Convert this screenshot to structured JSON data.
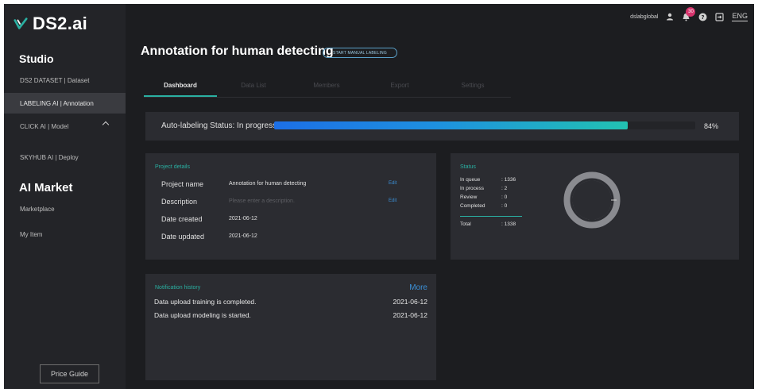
{
  "brand": {
    "name": "DS2.ai",
    "logo_icon": "check-logo-icon",
    "accent": "#2ab0a2"
  },
  "sidebar": {
    "studio_title": "Studio",
    "items": [
      {
        "label": "DS2 DATASET | Dataset"
      },
      {
        "label": "LABELING AI | Annotation",
        "active": true
      },
      {
        "label": "CLICK AI | Model",
        "icon": "chevron-up-icon"
      },
      {
        "label": "SKYHUB AI | Deploy"
      }
    ],
    "market_title": "AI Market",
    "market_items": [
      {
        "label": "Marketplace"
      },
      {
        "label": "My Item"
      }
    ],
    "price_guide": "Price Guide"
  },
  "topbar": {
    "username": "dslabglobal",
    "user_icon": "user-icon",
    "bell_icon": "bell-icon",
    "notification_count": "30",
    "help_icon": "help-icon",
    "logout_icon": "logout-icon",
    "language": "ENG"
  },
  "header": {
    "title": "Annotation for human detecting",
    "manual_button": "START MANUAL LABELING"
  },
  "tabs": [
    {
      "label": "Dashboard",
      "active": true
    },
    {
      "label": "Data List"
    },
    {
      "label": "Members"
    },
    {
      "label": "Export"
    },
    {
      "label": "Settings"
    }
  ],
  "progress": {
    "label": "Auto-labeling Status: In progress",
    "value": 0.84,
    "percent_text": "84%",
    "color_start": "#1c6fe6",
    "color_end": "#22c2b2"
  },
  "project_details": {
    "title": "Project details",
    "rows": [
      {
        "label": "Project name",
        "value": "Annotation for human detecting",
        "edit": "Edit"
      },
      {
        "label": "Description",
        "placeholder": "Please enter a description.",
        "edit": "Edit"
      },
      {
        "label": "Date created",
        "value": "2021-06-12"
      },
      {
        "label": "Date updated",
        "value": "2021-06-12"
      }
    ]
  },
  "status": {
    "title": "Status",
    "rows": [
      {
        "key": "In queue",
        "value": ": 1336"
      },
      {
        "key": "In process",
        "value": ": 2"
      },
      {
        "key": "Review",
        "value": ": 0"
      },
      {
        "key": "Completed",
        "value": ": 0"
      }
    ],
    "total": {
      "key": "Total",
      "value": ": 1338"
    }
  },
  "notifications": {
    "title": "Notification history",
    "more": "More",
    "items": [
      {
        "text": "Data upload training is completed.",
        "date": "2021-06-12"
      },
      {
        "text": "Data upload modeling is started.",
        "date": "2021-06-12"
      }
    ]
  }
}
